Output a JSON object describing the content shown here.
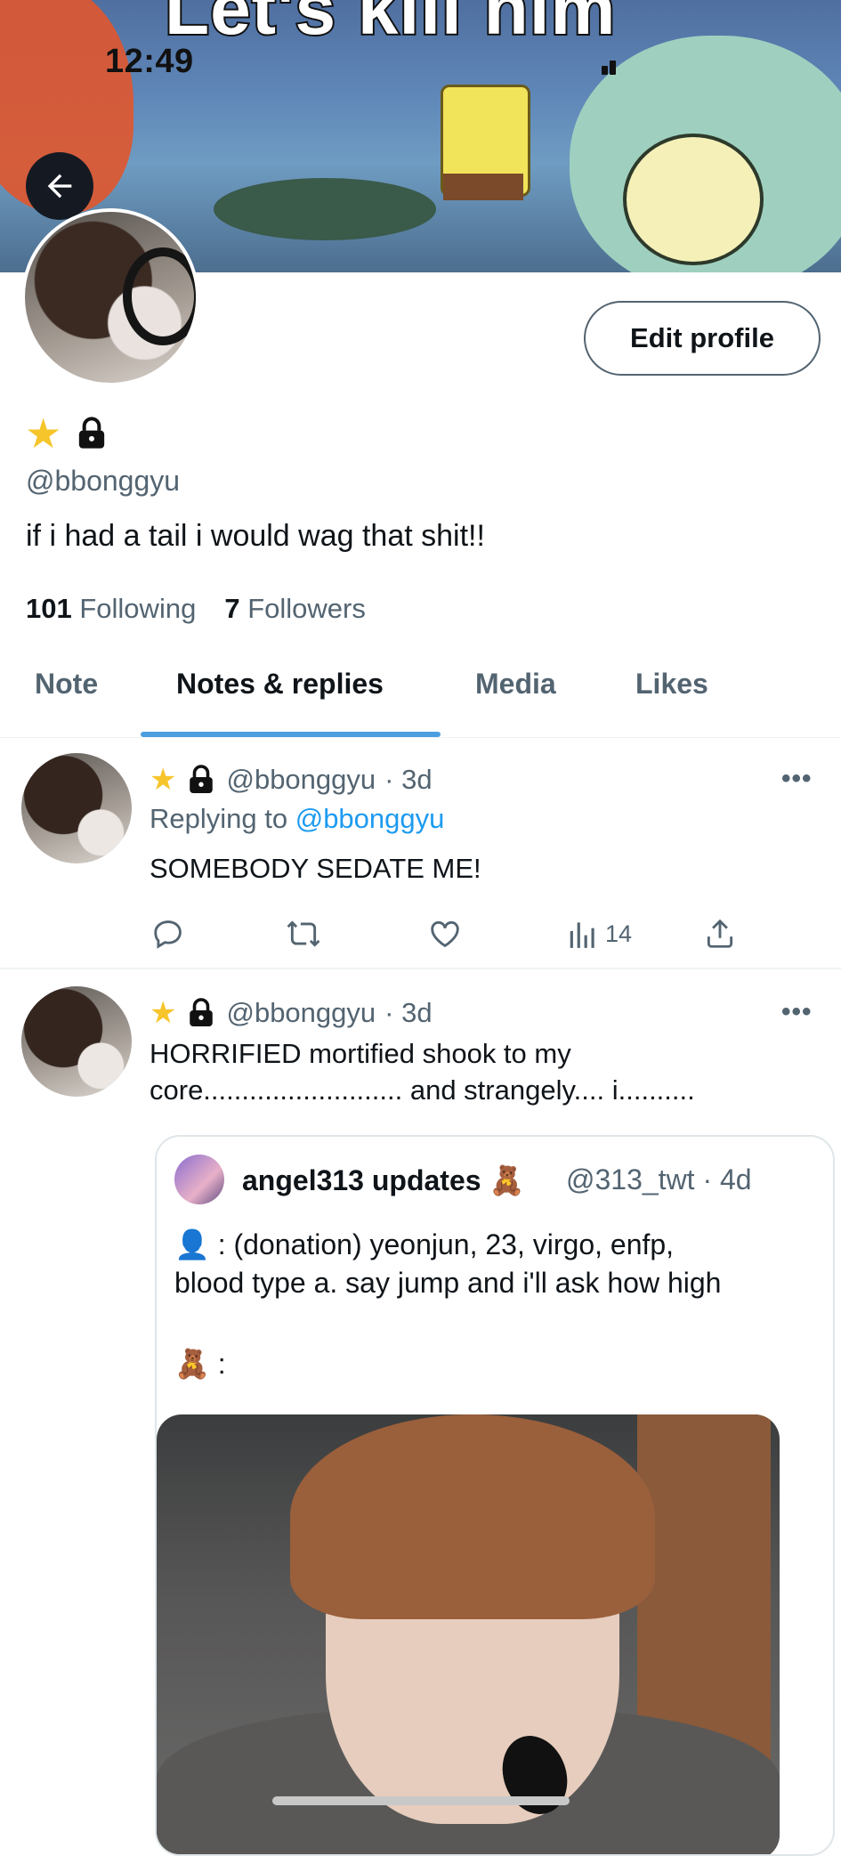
{
  "status_bar": {
    "time": "12:49"
  },
  "banner": {
    "caption": "Let's kill him"
  },
  "profile": {
    "edit_button": "Edit profile",
    "handle": "@bbonggyu",
    "bio": "if i had a tail i would wag that shit!!",
    "following_count": "101",
    "following_label": "Following",
    "followers_count": "7",
    "followers_label": "Followers",
    "badges": [
      "star-icon",
      "lock-icon"
    ]
  },
  "tabs": [
    {
      "label": "Note",
      "active": false
    },
    {
      "label": "Notes & replies",
      "active": true
    },
    {
      "label": "Media",
      "active": false
    },
    {
      "label": "Likes",
      "active": false
    }
  ],
  "tweets": [
    {
      "handle": "@bbonggyu",
      "time": "· 3d",
      "replying_prefix": "Replying to",
      "replying_handle": "@bbonggyu",
      "text": "SOMEBODY SEDATE ME!",
      "views": "14"
    },
    {
      "handle": "@bbonggyu",
      "time": "· 3d",
      "text_line1": "HORRIFIED mortified shook to my",
      "text_line2": "core.......................... and strangely.... i..........",
      "quote": {
        "name": "angel313 updates",
        "name_emoji": "🧸",
        "handle": "@313_twt · 4d",
        "text_line1": "👤 : (donation) yeonjun, 23, virgo, enfp,",
        "text_line2": "blood type a. say jump and i'll ask how high",
        "teddy_line": "🧸 :"
      }
    }
  ],
  "colors": {
    "accent": "#1d9bf0",
    "tab_underline": "#4b9fe0",
    "secondary_text": "#536471",
    "primary_text": "#0f1419"
  }
}
